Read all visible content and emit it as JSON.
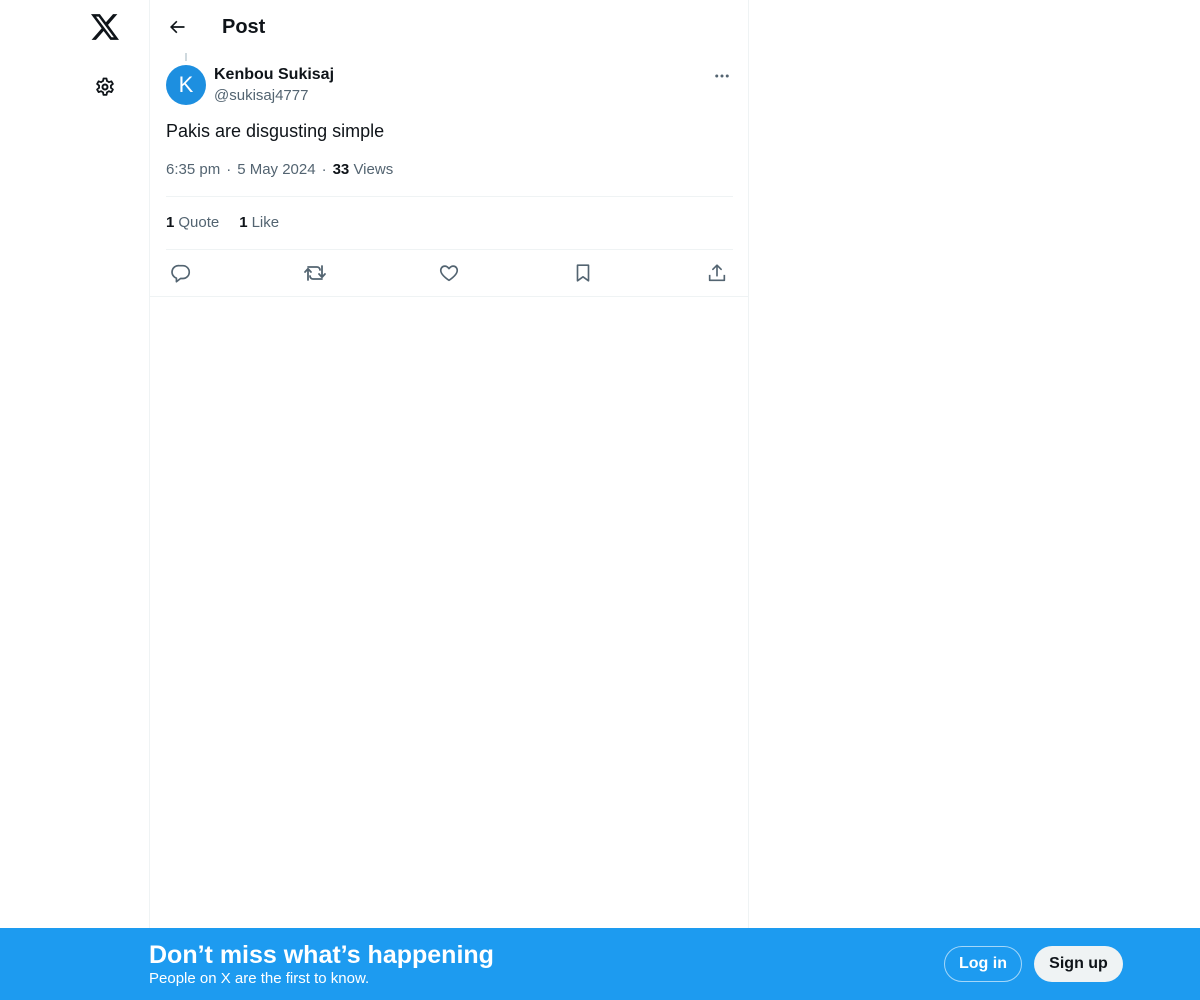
{
  "header": {
    "title": "Post"
  },
  "tweet": {
    "avatar_letter": "K",
    "avatar_color": "#1d8fe0",
    "display_name": "Kenbou Sukisaj",
    "handle": "@sukisaj4777",
    "text": "Pakis are disgusting simple",
    "time": "6:35 pm",
    "date": "5 May 2024",
    "views_count": "33",
    "views_label": "Views",
    "separator": "·"
  },
  "stats": {
    "quotes_count": "1",
    "quotes_label": "Quote",
    "likes_count": "1",
    "likes_label": "Like"
  },
  "icons": {
    "logo": "x-logo-icon",
    "settings": "gear-icon",
    "back": "arrow-left-icon",
    "more": "more-horizontal-icon",
    "reply": "reply-icon",
    "retweet": "retweet-icon",
    "like": "heart-icon",
    "bookmark": "bookmark-icon",
    "share": "share-icon"
  },
  "banner": {
    "title": "Don’t miss what’s happening",
    "subtitle": "People on X are the first to know.",
    "login_label": "Log in",
    "signup_label": "Sign up",
    "background_color": "#1d9bf0"
  }
}
